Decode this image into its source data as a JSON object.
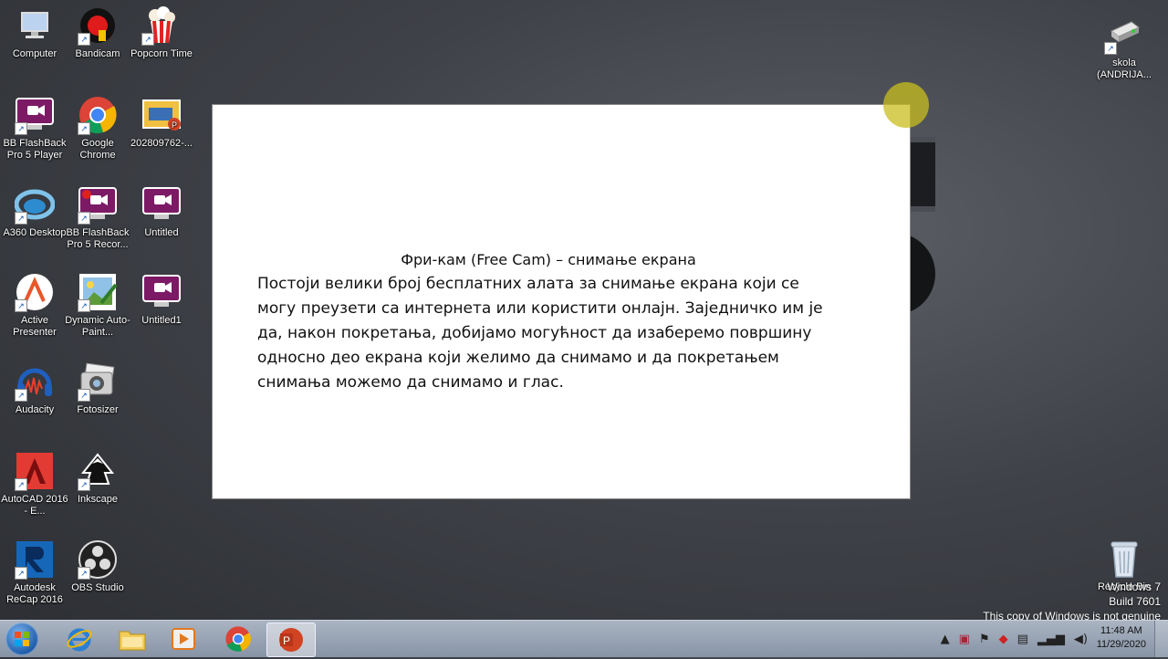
{
  "desktop": {
    "icons": [
      {
        "label": "Computer",
        "icon": "computer-icon"
      },
      {
        "label": "Bandicam",
        "icon": "bandicam-icon"
      },
      {
        "label": "Popcorn Time",
        "icon": "popcorn-icon"
      },
      {
        "label": "BB FlashBack Pro 5 Player",
        "icon": "flashback-player-icon"
      },
      {
        "label": "Google Chrome",
        "icon": "chrome-icon"
      },
      {
        "label": "202809762-...",
        "icon": "pptx-file-icon"
      },
      {
        "label": "A360 Desktop",
        "icon": "a360-icon"
      },
      {
        "label": "BB FlashBack Pro 5 Recor...",
        "icon": "flashback-recorder-icon"
      },
      {
        "label": "Untitled",
        "icon": "flashback-file-icon"
      },
      {
        "label": "Active Presenter",
        "icon": "activepresenter-icon"
      },
      {
        "label": "Dynamic Auto-Paint...",
        "icon": "dynamic-autopainter-icon"
      },
      {
        "label": "Untitled1",
        "icon": "flashback-file-icon"
      },
      {
        "label": "Audacity",
        "icon": "audacity-icon"
      },
      {
        "label": "Fotosizer",
        "icon": "fotosizer-icon"
      },
      {
        "label": "AutoCAD 2016 - E...",
        "icon": "autocad-icon"
      },
      {
        "label": "Inkscape",
        "icon": "inkscape-icon"
      },
      {
        "label": "Autodesk ReCap 2016",
        "icon": "recap-icon"
      },
      {
        "label": "OBS Studio",
        "icon": "obs-icon"
      },
      {
        "label": "skola (ANDRIJA...",
        "icon": "network-drive-icon"
      },
      {
        "label": "Recycle Bin",
        "icon": "recycle-bin-icon"
      }
    ]
  },
  "slide": {
    "title": "Фри-кам (Free Cam) – снимање екрана",
    "body": "Постоји велики број бесплатних алата за снимање екрана који се могу преузети са интернета или користити онлајн. Заједничко им је да, након покретања, добијамо могућност да изаберемо површину односно део екрана који желимо да снимамо и да покретањем снимања можемо да снимамо и глас."
  },
  "watermark": {
    "line1": "Windows 7",
    "line2": "Build 7601",
    "line3": "This copy of Windows is not genuine"
  },
  "taskbar": {
    "apps": [
      "internet-explorer-icon",
      "file-explorer-icon",
      "media-player-icon",
      "chrome-icon",
      "powerpoint-icon"
    ],
    "clock_time": "11:48 AM",
    "clock_date": "11/29/2020"
  },
  "colors": {
    "accent": "#c8be1e",
    "taskbar": "#8794a6"
  }
}
